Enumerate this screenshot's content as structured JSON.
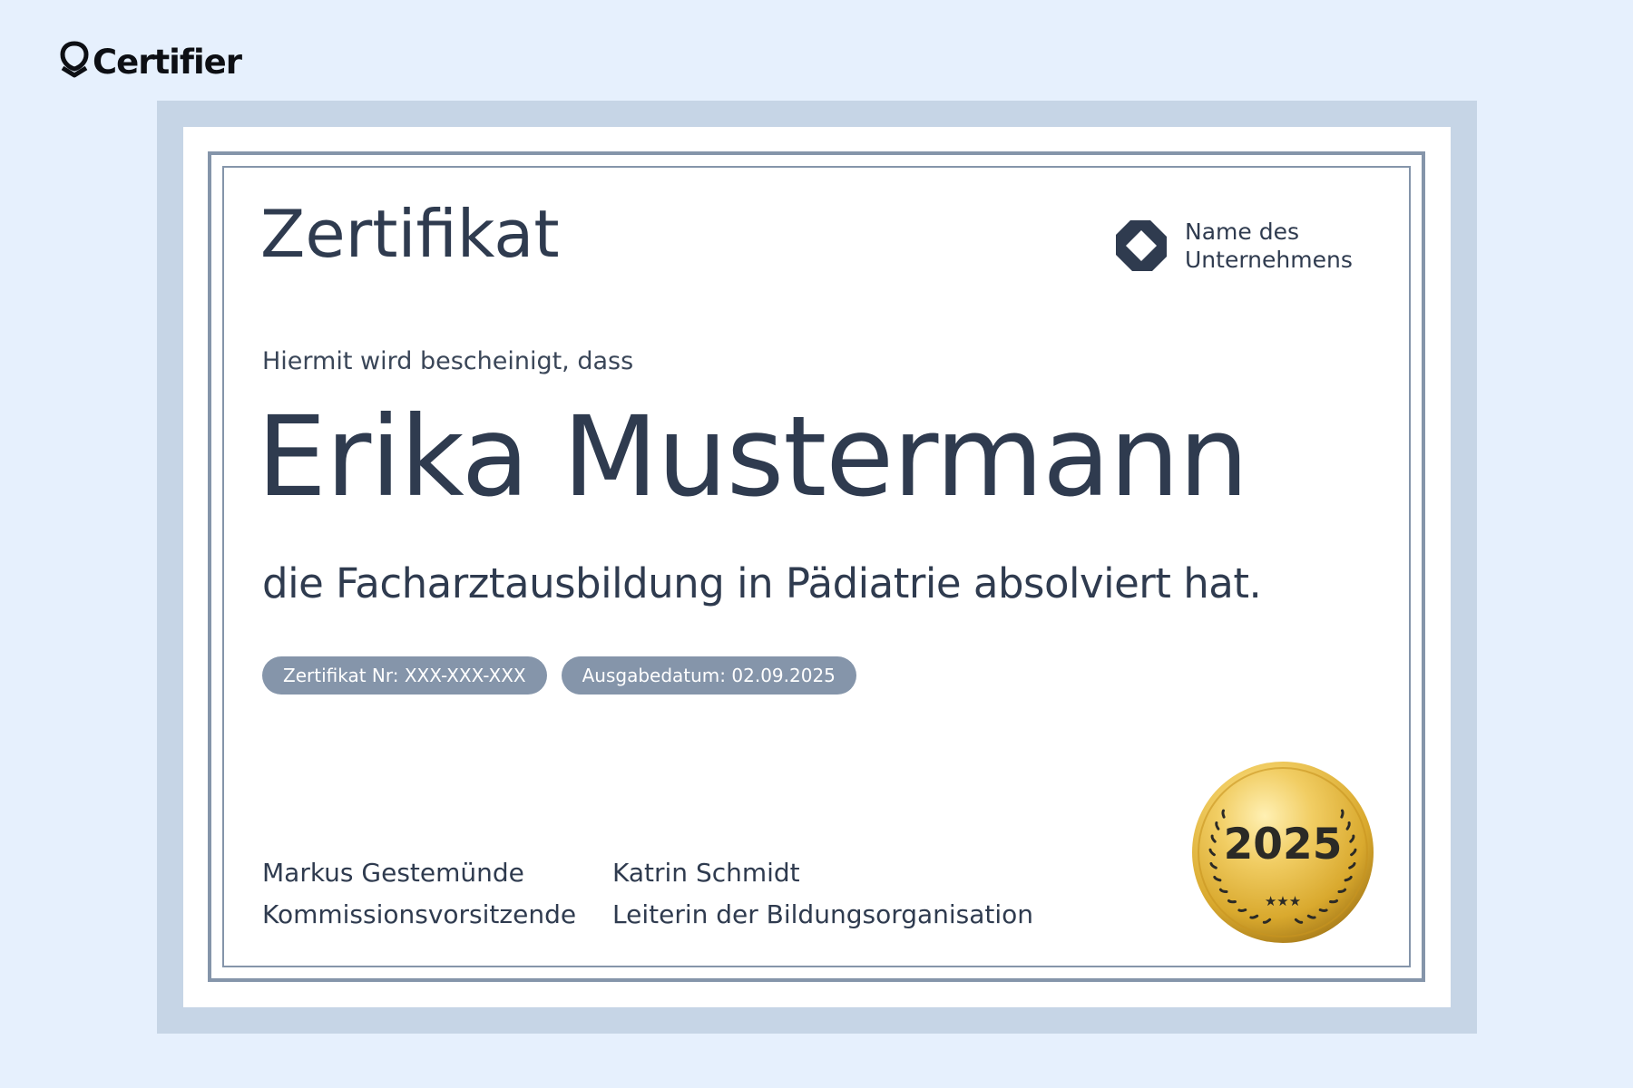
{
  "brand": {
    "name": "Certifier",
    "icon": "certifier-logo-icon"
  },
  "certificate": {
    "title": "Zertifikat",
    "company": {
      "line1": "Name des",
      "line2": "Unternehmens",
      "icon": "company-logo-icon"
    },
    "intro": "Hiermit wird bescheinigt, dass",
    "recipient": "Erika Mustermann",
    "achievement": "die Facharztausbildung in Pädiatrie absolviert hat.",
    "certificate_number": "Zertifikat Nr: XXX-XXX-XXX",
    "issue_date": "Ausgabedatum: 02.09.2025",
    "signatories": [
      {
        "name": "Markus Gestemünde",
        "role": "Kommissionsvorsitzende"
      },
      {
        "name": "Katrin Schmidt",
        "role": "Leiterin der Bildungsorganisation"
      }
    ],
    "seal": {
      "year": "2025",
      "stars": "★★★",
      "icon": "gold-seal-icon"
    }
  },
  "colors": {
    "background": "#e6f0fd",
    "mat": "#c6d5e6",
    "frame": "#8595aa",
    "text": "#2f3b4f",
    "badge": "#8595aa",
    "seal_gold": "#d9a92e"
  }
}
